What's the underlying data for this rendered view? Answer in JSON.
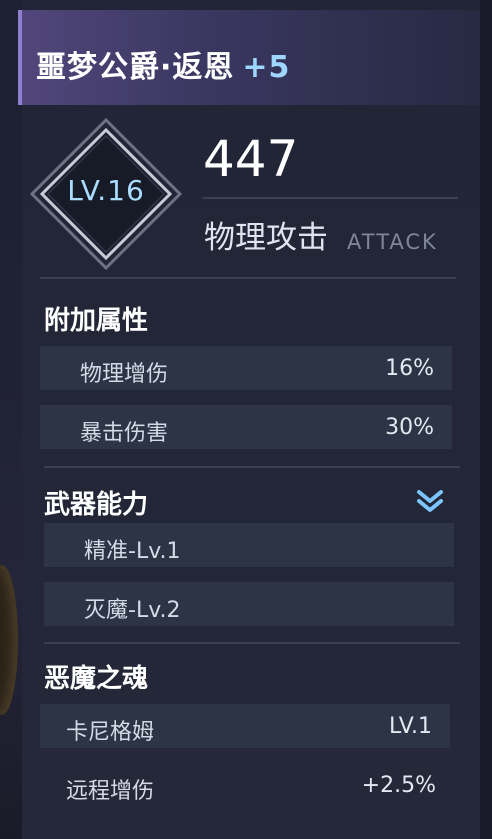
{
  "weapon": {
    "name": "噩梦公爵·返恩",
    "upgrade": "+5",
    "level": "LV.16",
    "attack_value": "447",
    "attack_label": "物理攻击",
    "attack_label_en": "ATTACK"
  },
  "bonus_attributes": {
    "title": "附加属性",
    "items": [
      {
        "label": "物理增伤",
        "value": "16%"
      },
      {
        "label": "暴击伤害",
        "value": "30%"
      }
    ]
  },
  "weapon_abilities": {
    "title": "武器能力",
    "items": [
      {
        "label": "精准-Lv.1"
      },
      {
        "label": "灭魔-Lv.2"
      }
    ]
  },
  "demon_soul": {
    "title": "恶魔之魂",
    "name": "卡尼格姆",
    "level": "LV.1",
    "effect_label": "远程增伤",
    "effect_value": "+2.5%"
  },
  "icons": {
    "expand": "chevron-double-down-icon",
    "level_frame": "diamond-frame-icon"
  },
  "colors": {
    "accent_blue": "#9fd6ff",
    "title_purple": "#51467b",
    "panel_bg": "#222637",
    "row_bg": "#2d3445"
  }
}
